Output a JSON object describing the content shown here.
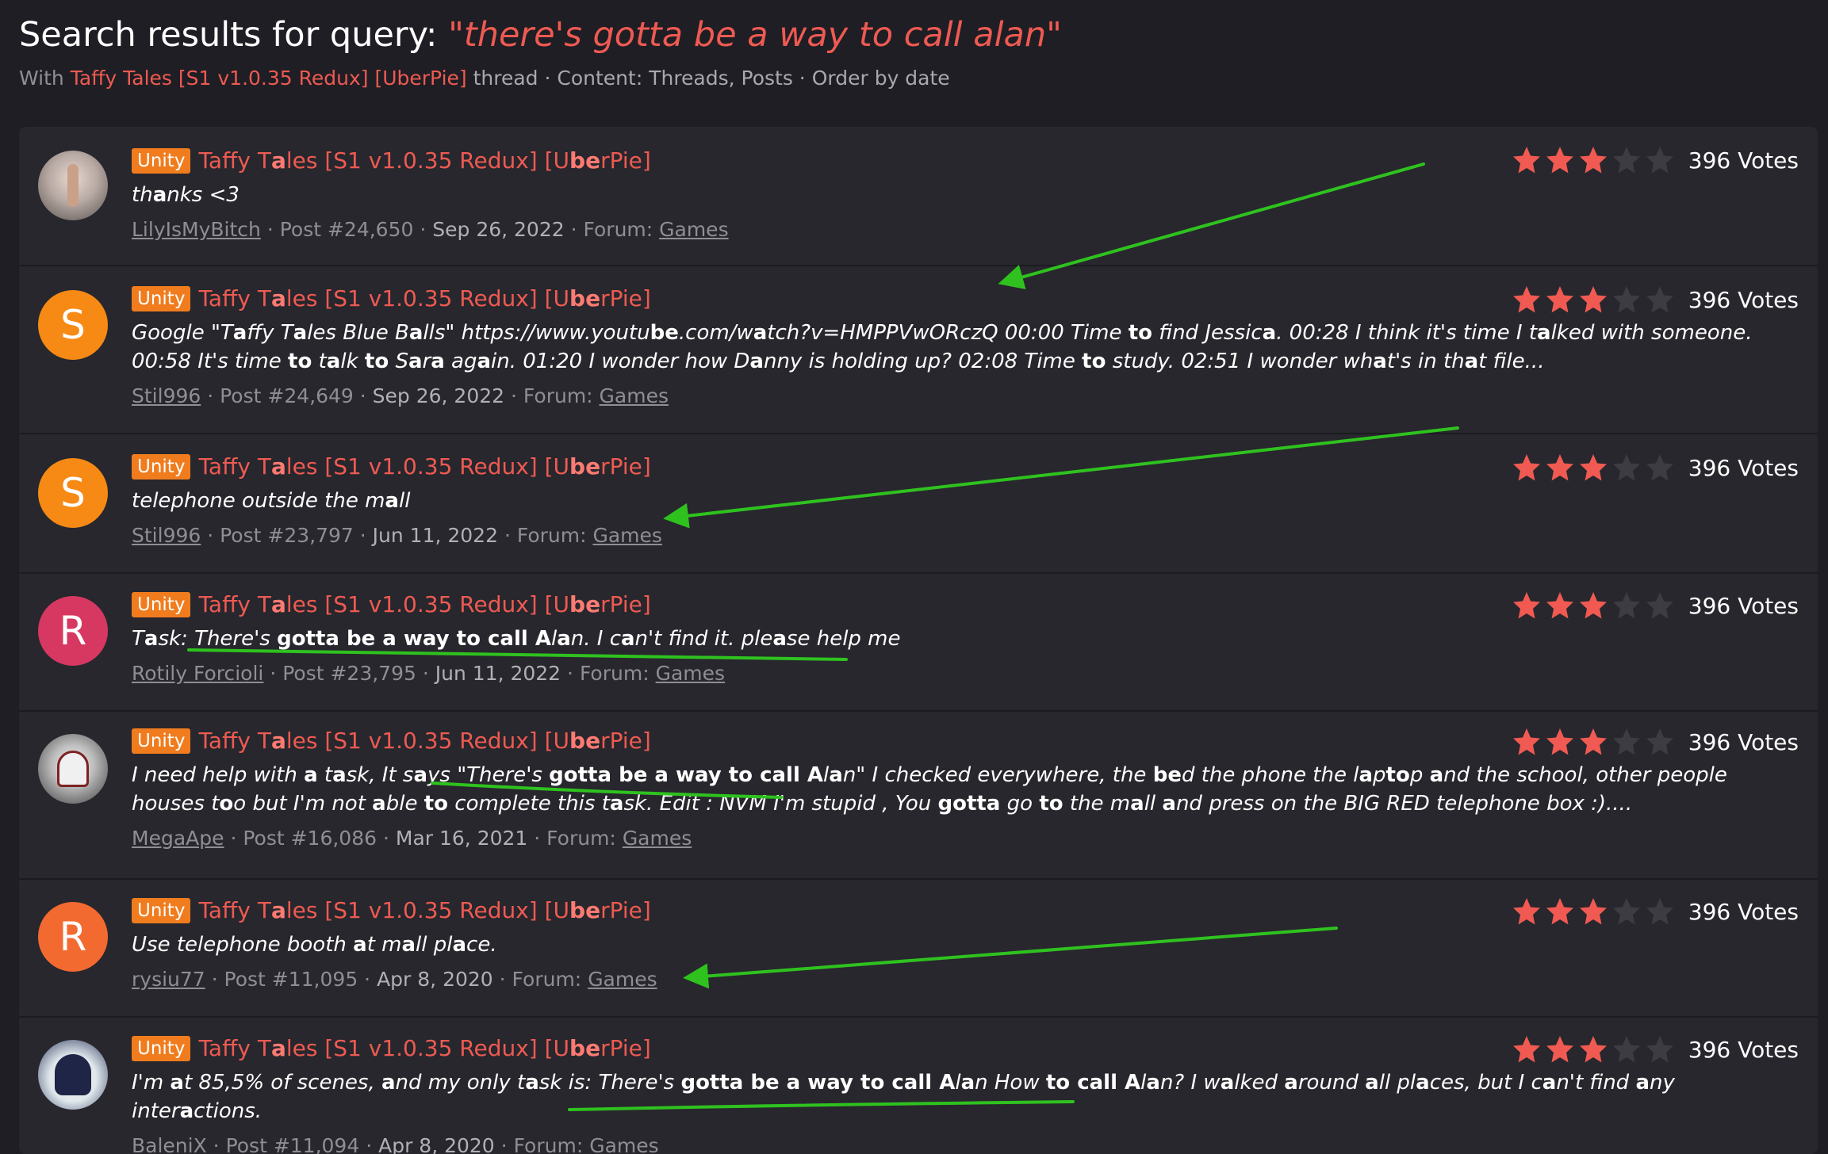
{
  "header": {
    "title_prefix": "Search results for query:",
    "query": "\"there's gotta be a way to call alan\"",
    "with_label": "With",
    "thread": "Taffy Tales [S1 v1.0.35 Redux] [UberPie]",
    "thread_suffix": "thread",
    "content_label": " · Content: Threads, Posts · Order by date"
  },
  "colors": {
    "accent": "#ee5a52",
    "badge": "#f07c1e",
    "star_on": "#f05a52",
    "star_off": "#3c3c42",
    "annotation": "#2fc21f"
  },
  "results": [
    {
      "avatar_type": "image",
      "badge": "Unity",
      "thread": "Taffy Tales [S1 v1.0.35 Redux] [UberPie]",
      "snippet": "thanks <3",
      "user": "LilyIsMyBitch",
      "post": "Post #24,650",
      "date": "Sep 26, 2022",
      "forum_label": "Forum:",
      "forum": "Games",
      "rating": 3,
      "votes": "396 Votes"
    },
    {
      "avatar_type": "letter",
      "avatar": "S",
      "avatar_color": "#f68a15",
      "badge": "Unity",
      "thread": "Taffy Tales [S1 v1.0.35 Redux] [UberPie]",
      "snippet": "Google \"Taffy Tales Blue Balls\" https://www.youtube.com/watch?v=HMPPVwORczQ 00:00 Time to find Jessica. 00:28 I think it's time I talked with someone. 00:58 It's time to talk to Sara again. 01:20 I wonder how Danny is holding up? 02:08 Time to study. 02:51 I wonder what's in that file...",
      "user": "Stil996",
      "post": "Post #24,649",
      "date": "Sep 26, 2022",
      "forum_label": "Forum:",
      "forum": "Games",
      "rating": 3,
      "votes": "396 Votes"
    },
    {
      "avatar_type": "letter",
      "avatar": "S",
      "avatar_color": "#f68a15",
      "badge": "Unity",
      "thread": "Taffy Tales [S1 v1.0.35 Redux] [UberPie]",
      "snippet": "telephone outside the mall",
      "user": "Stil996",
      "post": "Post #23,797",
      "date": "Jun 11, 2022",
      "forum_label": "Forum:",
      "forum": "Games",
      "rating": 3,
      "votes": "396 Votes"
    },
    {
      "avatar_type": "letter",
      "avatar": "R",
      "avatar_color": "#d63862",
      "badge": "Unity",
      "thread": "Taffy Tales [S1 v1.0.35 Redux] [UberPie]",
      "snippet": "Task: There's gotta be a way to call Alan. I can't find it. please help me",
      "user": "Rotily Forcioli",
      "post": "Post #23,795",
      "date": "Jun 11, 2022",
      "forum_label": "Forum:",
      "forum": "Games",
      "rating": 3,
      "votes": "396 Votes"
    },
    {
      "avatar_type": "image",
      "badge": "Unity",
      "thread": "Taffy Tales [S1 v1.0.35 Redux] [UberPie]",
      "snippet": "I need help with a task, It says \"There's gotta be a way to call Alan\" I checked everywhere, the bed the phone the laptop and the school, other people houses too but I'm not able to complete this task. Edit : NVM I'm stupid , You gotta go to the mall and press on the BIG RED telephone box :)....",
      "user": "MegaApe",
      "post": "Post #16,086",
      "date": "Mar 16, 2021",
      "forum_label": "Forum:",
      "forum": "Games",
      "rating": 3,
      "votes": "396 Votes"
    },
    {
      "avatar_type": "letter",
      "avatar": "R",
      "avatar_color": "#f36a30",
      "badge": "Unity",
      "thread": "Taffy Tales [S1 v1.0.35 Redux] [UberPie]",
      "snippet": "Use telephone booth at mall place.",
      "user": "rysiu77",
      "post": "Post #11,095",
      "date": "Apr 8, 2020",
      "forum_label": "Forum:",
      "forum": "Games",
      "rating": 3,
      "votes": "396 Votes"
    },
    {
      "avatar_type": "image",
      "badge": "Unity",
      "thread": "Taffy Tales [S1 v1.0.35 Redux] [UberPie]",
      "snippet": "I'm at 85,5% of scenes, and my only task is: There's gotta be a way to call Alan How to call Alan? I walked around all places, but I can't find any interactions.",
      "user": "BaleniX",
      "post": "Post #11,094",
      "date": "Apr 8, 2020",
      "forum_label": "Forum:",
      "forum": "Games",
      "rating": 3,
      "votes": "396 Votes"
    }
  ]
}
